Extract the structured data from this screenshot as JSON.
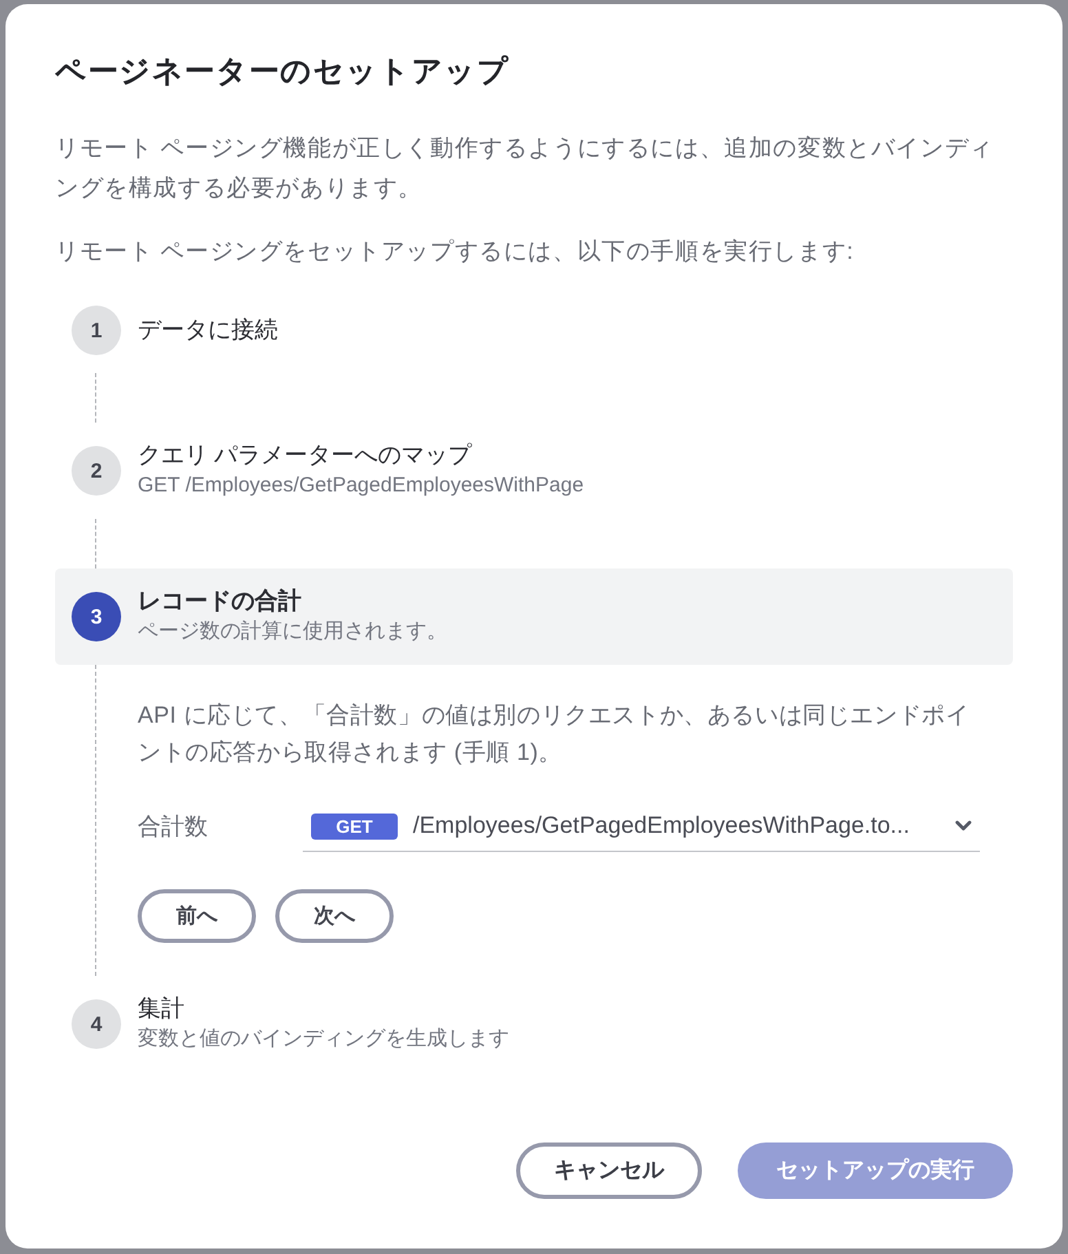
{
  "dialog": {
    "title": "ページネーターのセットアップ",
    "paragraphs": [
      "リモート ページング機能が正しく動作するようにするには、追加の変数とバインディングを構成する必要があります。",
      "リモート ページングをセットアップするには、以下の手順を実行します:"
    ]
  },
  "steps": [
    {
      "number": "1",
      "title": "データに接続",
      "selected": false
    },
    {
      "number": "2",
      "title": "クエリ パラメーターへのマップ",
      "subtitle": "GET /Employees/GetPagedEmployeesWithPage",
      "selected": false
    },
    {
      "number": "3",
      "title": "レコードの合計",
      "subtitle": "ページ数の計算に使用されます。",
      "selected": true,
      "content": {
        "description": "API に応じて、「合計数」の値は別のリクエストか、あるいは同じエンドポイントの応答から取得されます (手順 1)。",
        "field": {
          "label": "合計数",
          "method": "GET",
          "value": "/Employees/GetPagedEmployeesWithPage.to..."
        },
        "buttons": [
          "前へ",
          "次へ"
        ]
      }
    },
    {
      "number": "4",
      "title": "集計",
      "subtitle": "変数と値のバインディングを生成します",
      "selected": false
    }
  ],
  "footer": {
    "buttons": [
      {
        "label": "キャンセル",
        "kind": "secondary",
        "disabled": false
      },
      {
        "label": "セットアップの実行",
        "kind": "primary",
        "disabled": true
      }
    ]
  }
}
